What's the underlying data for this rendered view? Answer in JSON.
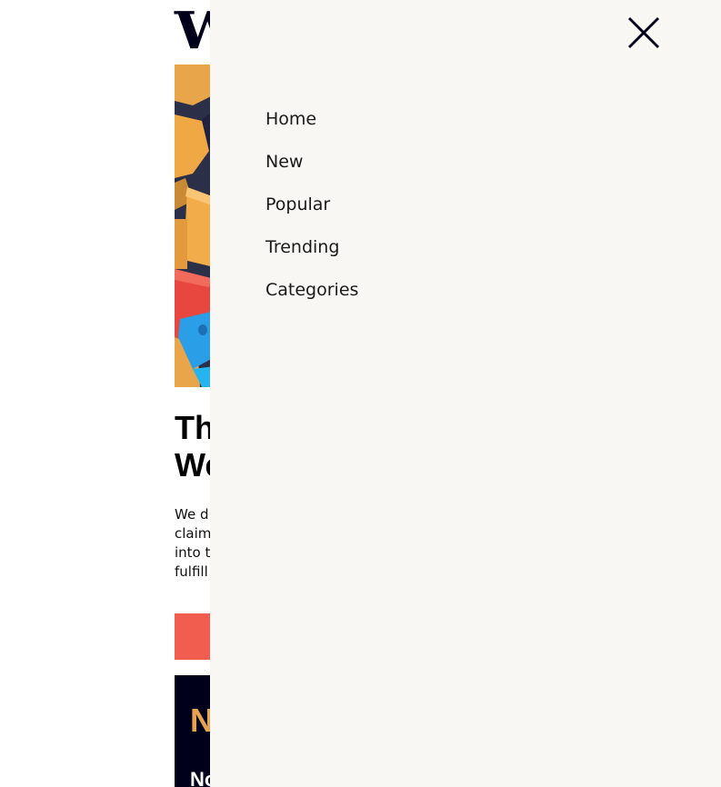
{
  "site": {
    "logo_text": "W"
  },
  "article": {
    "headline": "Th We",
    "intro": "We d claim into t fulfill",
    "cta_label": "",
    "panel_title": "N",
    "panel_subtitle": "No"
  },
  "drawer": {
    "close_icon": "close-icon",
    "menu": [
      {
        "label": "Home"
      },
      {
        "label": "New"
      },
      {
        "label": "Popular"
      },
      {
        "label": "Trending"
      },
      {
        "label": "Categories"
      }
    ]
  },
  "colors": {
    "drawer_background": "#f8f7f4",
    "accent_coral": "#f15e50",
    "accent_orange": "#e9a350",
    "navy": "#00001a",
    "text": "#1a1a1a"
  }
}
